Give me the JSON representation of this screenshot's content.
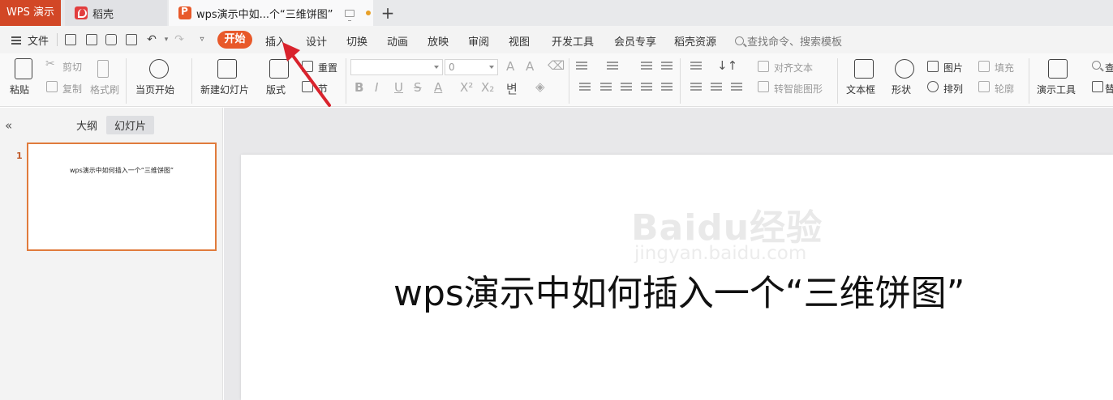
{
  "tabs": {
    "app": "WPS 演示",
    "daoke": "稻壳",
    "document": "wps演示中如...个“三维饼图”",
    "new_tab": "+"
  },
  "menu": {
    "file": "文件",
    "items": [
      "开始",
      "插入",
      "设计",
      "切换",
      "动画",
      "放映",
      "审阅",
      "视图",
      "开发工具",
      "会员专享",
      "稻壳资源"
    ],
    "search": "查找命令、搜索模板"
  },
  "ribbon": {
    "paste": "粘贴",
    "cut": "剪切",
    "copy": "复制",
    "format_painter": "格式刷",
    "from_start": "当页开始",
    "new_slide": "新建幻灯片",
    "layout": "版式",
    "reset": "重置",
    "section": "节",
    "font_size": "0",
    "align_text": "对齐文本",
    "smart_shape": "转智能图形",
    "text_box": "文本框",
    "shape": "形状",
    "picture": "图片",
    "arrange": "排列",
    "fill": "填充",
    "outline": "轮廓",
    "presentation_tools": "演示工具",
    "find_partial": "查",
    "replace_partial": "替"
  },
  "left_pane": {
    "outline_tab": "大纲",
    "slides_tab": "幻灯片",
    "slide_number": "1",
    "thumb_title": "wps演示中如何插入一个“三维饼图”"
  },
  "slide": {
    "title": "wps演示中如何插入一个“三维饼图”"
  },
  "watermark": {
    "main": "Baidu经验",
    "sub": "jingyan.baidu.com"
  },
  "colors": {
    "accent": "#e8592a",
    "app_tab": "#d24726",
    "annotation_arrow": "#d9232d"
  }
}
